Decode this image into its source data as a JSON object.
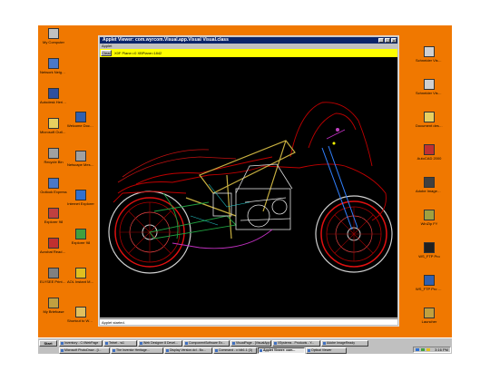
{
  "desktop": {
    "left_icons": [
      {
        "label": "My Computer",
        "color": "#c0c0c0"
      },
      {
        "label": "Network Neighborhood",
        "color": "#4a78c8"
      },
      {
        "label": "Autodesk Heritage Ce...",
        "color": "#3050a0"
      },
      {
        "label": "Microsoft Outlook",
        "color": "#e8d060"
      },
      {
        "label": "Recycle Bin",
        "color": "#a0a0a0"
      },
      {
        "label": "Outlook Express",
        "color": "#4a78c8"
      },
      {
        "label": "Explorer 98",
        "color": "#c04040"
      },
      {
        "label": "Acrobat Reader 4.0",
        "color": "#c03030"
      },
      {
        "label": "ELYSEE Printer to PC",
        "color": "#808080"
      },
      {
        "label": "My Briefcase",
        "color": "#c0a040"
      }
    ],
    "left_col2_icons": [
      {
        "label": "Welcome Documentatio",
        "color": "#3060b0"
      },
      {
        "label": "Netscape Messenger",
        "color": "#a0a0a0"
      },
      {
        "label": "Internet Explorer",
        "color": "#3070d0"
      },
      {
        "label": "Explorer 98",
        "color": "#40a040"
      },
      {
        "label": "AOL Instant Messeng...",
        "color": "#e0c020"
      },
      {
        "label": "Shortcut to Weeds",
        "color": "#e0c060"
      }
    ],
    "right_icons": [
      {
        "label": "Schneider Visual Cafe",
        "color": "#d0d0d0"
      },
      {
        "label": "Schneider Visual Page",
        "color": "#d0d0d0"
      },
      {
        "label": "Document desktop",
        "color": "#e8d060"
      },
      {
        "label": "AutoCAD 2000",
        "color": "#c03030"
      },
      {
        "label": "Adobe ImageRea...",
        "color": "#404040"
      },
      {
        "label": "WinZip FY",
        "color": "#a0a040"
      },
      {
        "label": "WS_FTP Pro",
        "color": "#202020"
      },
      {
        "label": "WS_FTP Pro Explorer",
        "color": "#3060b0"
      },
      {
        "label": "Launcher",
        "color": "#c0a040"
      }
    ]
  },
  "window": {
    "title": "Applet Viewer: com.wyrcom.Visual.app.Visual Visual.class",
    "menu": "Applet",
    "clear_label": "Clear",
    "coords_text": "X0F Plane:=0 XBPlane=1842",
    "status": "Applet started.",
    "titlebar_color": "#0a246a",
    "toolbar_color": "#ffff00"
  },
  "taskbar": {
    "start_label": "Start",
    "tasks_top": [
      "Inventory - C:\\WebPage",
      "Telnet - w1",
      "Web Designer 8 Devel...",
      "ComponentSoftware Ex...",
      "VisualPage - [VisualApp",
      "\\\\Systems - Products - Y...",
      "Adobe ImageReady"
    ],
    "tasks_bottom": [
      "Microsoft PhotoDraw - [I...",
      "The Inventor Heritage...",
      "Display Version.dcl - Bo...",
      "Command - c:\\db1.1 (3)",
      "Applet Viewer: com...",
      "Optical Viewer"
    ],
    "active_index": 4,
    "clock": "3:16 PM"
  }
}
